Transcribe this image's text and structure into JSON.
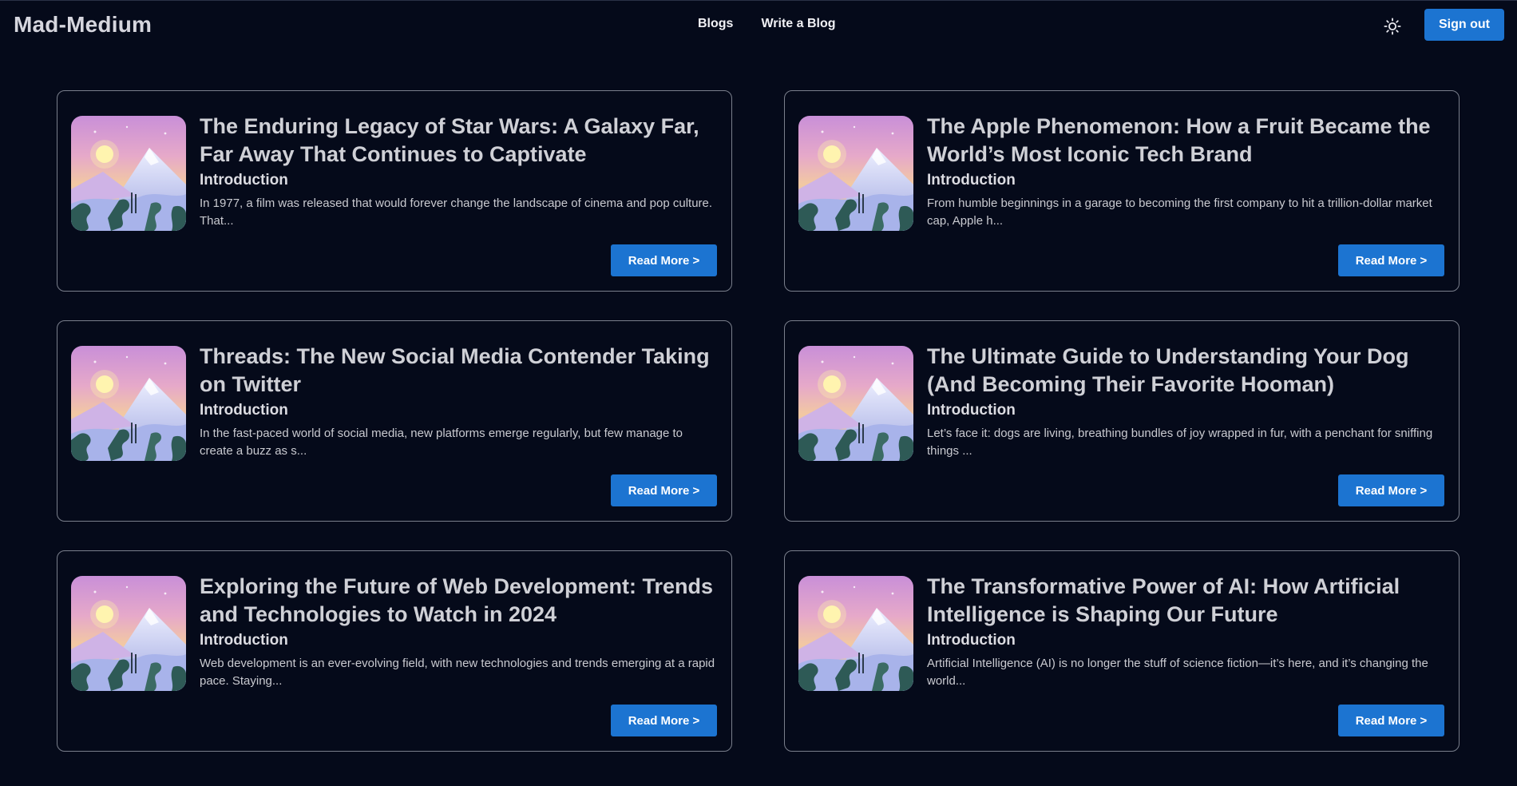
{
  "brand": "Mad-Medium",
  "nav": {
    "blogs": "Blogs",
    "write": "Write a Blog"
  },
  "header": {
    "theme_icon": "sun-icon",
    "signout_label": "Sign out"
  },
  "colors": {
    "background": "#050a1a",
    "accent": "#1c74d1",
    "card_border": "#7a7f8c"
  },
  "posts": [
    {
      "title": "The Enduring Legacy of Star Wars: A Galaxy Far, Far Away That Continues to Captivate",
      "subtitle": "Introduction",
      "excerpt": "In 1977, a film was released that would forever change the landscape of cinema and pop culture. That...",
      "read_more": "Read More >"
    },
    {
      "title": "The Apple Phenomenon: How a Fruit Became the World’s Most Iconic Tech Brand",
      "subtitle": "Introduction",
      "excerpt": "From humble beginnings in a garage to becoming the first company to hit a trillion-dollar market cap, Apple h...",
      "read_more": "Read More >"
    },
    {
      "title": "Threads: The New Social Media Contender Taking on Twitter",
      "subtitle": "Introduction",
      "excerpt": "In the fast-paced world of social media, new platforms emerge regularly, but few manage to create a buzz as s...",
      "read_more": "Read More >"
    },
    {
      "title": "The Ultimate Guide to Understanding Your Dog (And Becoming Their Favorite Hooman)",
      "subtitle": "Introduction",
      "excerpt": "Let’s face it: dogs are living, breathing bundles of joy wrapped in fur, with a penchant for sniffing things ...",
      "read_more": "Read More >"
    },
    {
      "title": "Exploring the Future of Web Development: Trends and Technologies to Watch in 2024",
      "subtitle": "Introduction",
      "excerpt": "Web development is an ever-evolving field, with new technologies and trends emerging at a rapid pace. Staying...",
      "read_more": "Read More >"
    },
    {
      "title": "The Transformative Power of AI: How Artificial Intelligence is Shaping Our Future",
      "subtitle": "Introduction",
      "excerpt": "Artificial Intelligence (AI) is no longer the stuff of science fiction—it’s here, and it’s changing the world...",
      "read_more": "Read More >"
    }
  ]
}
